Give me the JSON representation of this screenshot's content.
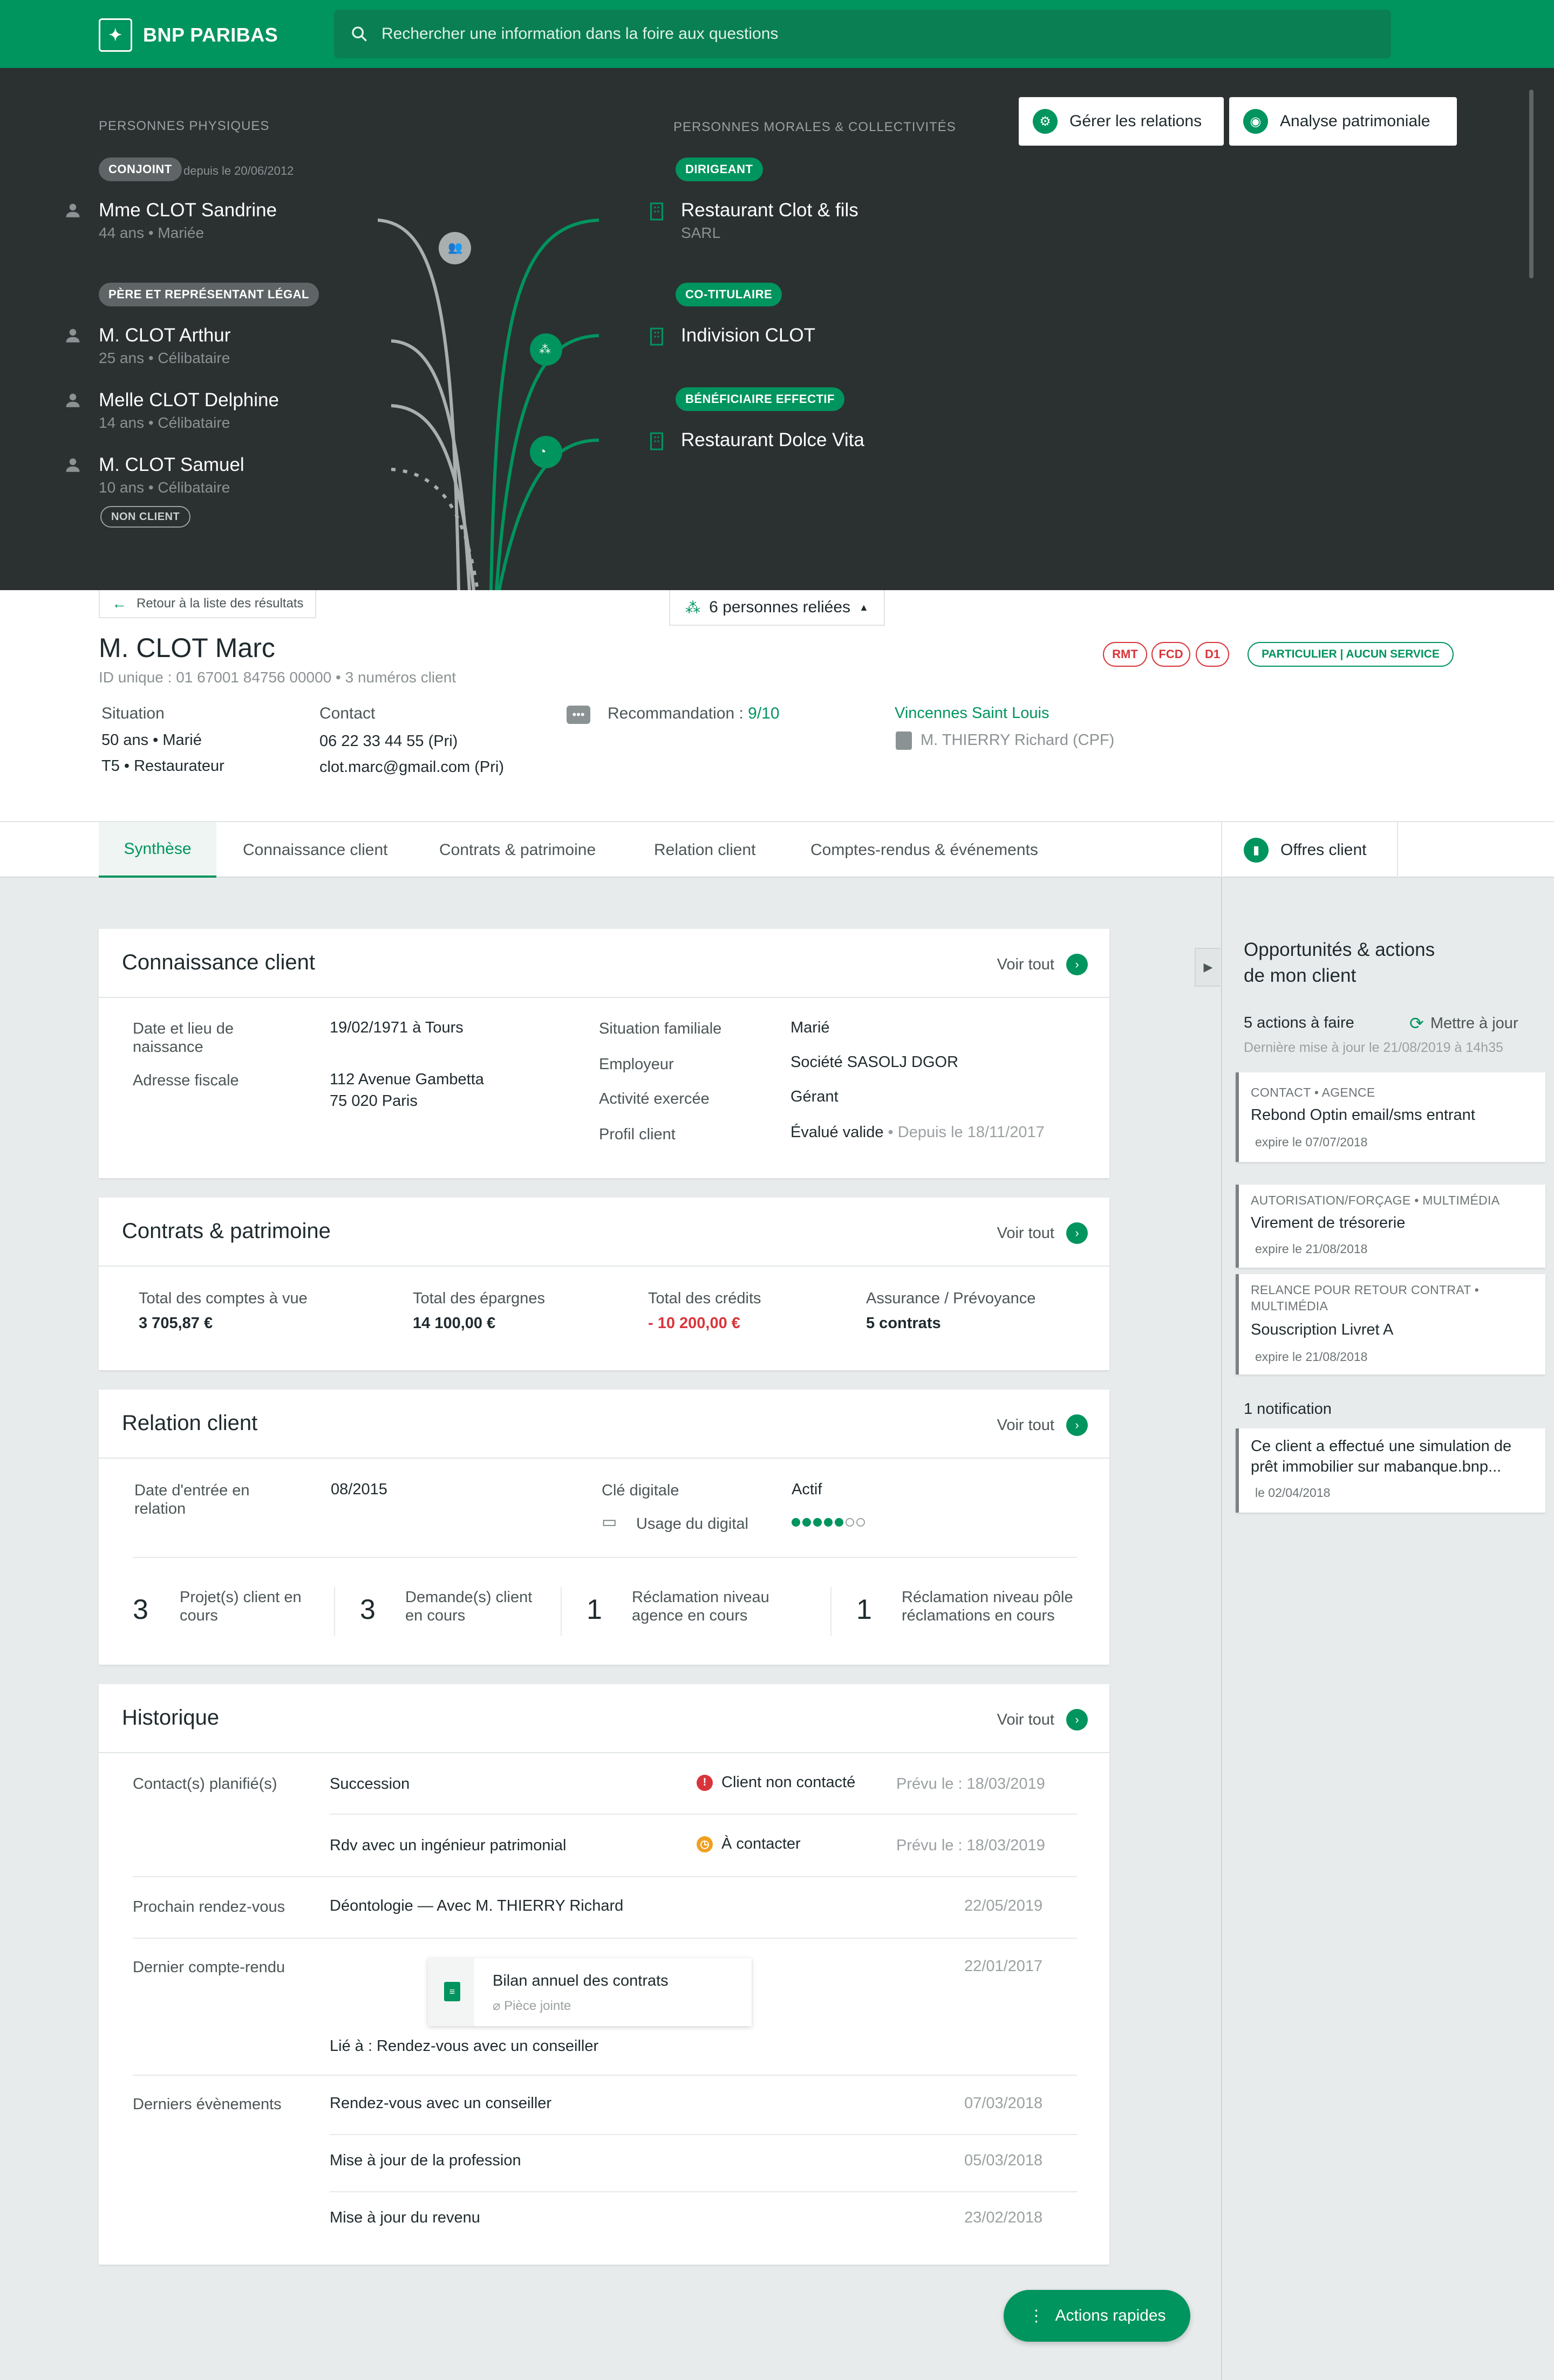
{
  "header": {
    "brand": "BNP PARIBAS",
    "search_placeholder": "Rechercher une information dans la foire aux questions"
  },
  "relations": {
    "physical_label": "PERSONNES PHYSIQUES",
    "moral_label": "PERSONNES MORALES & COLLECTIVITÉS",
    "manage_button": "Gérer les relations",
    "analysis_button": "Analyse patrimoniale",
    "physical": [
      {
        "tag": "CONJOINT",
        "since": "depuis le 20/06/2012",
        "name": "Mme CLOT Sandrine",
        "sub": "44 ans • Mariée"
      },
      {
        "tag": "PÈRE ET REPRÉSENTANT LÉGAL",
        "name": "M. CLOT Arthur",
        "sub": "25 ans • Célibataire"
      },
      {
        "name": "Melle CLOT Delphine",
        "sub": "14 ans • Célibataire"
      },
      {
        "name": "M. CLOT Samuel",
        "sub": "10 ans • Célibataire",
        "badge": "NON CLIENT"
      }
    ],
    "moral": [
      {
        "tag": "DIRIGEANT",
        "name": "Restaurant Clot & fils",
        "sub": "SARL"
      },
      {
        "tag": "CO-TITULAIRE",
        "name": "Indivision CLOT"
      },
      {
        "tag": "BÉNÉFICIAIRE EFFECTIF",
        "name": "Restaurant Dolce Vita"
      }
    ]
  },
  "client": {
    "back_label": "Retour à la liste des résultats",
    "linked_label": "6 personnes reliées",
    "name": "M. CLOT Marc",
    "id_line": "ID unique : 01 67001 84756 00000 • 3 numéros client",
    "tags": [
      "RMT",
      "FCD",
      "D1"
    ],
    "segment": "PARTICULIER | AUCUN SERVICE",
    "situation_label": "Situation",
    "situation_1": "50 ans • Marié",
    "situation_2": "T5 • Restaurateur",
    "contact_label": "Contact",
    "phone": "06 22 33 44 55 (Pri)",
    "email": "clot.marc@gmail.com (Pri)",
    "reco_label": "Recommandation :",
    "reco_value": "9/10",
    "agency": "Vincennes Saint Louis",
    "advisor": "M. THIERRY Richard (CPF)"
  },
  "tabs": [
    "Synthèse",
    "Connaissance client",
    "Contrats & patrimoine",
    "Relation client",
    "Comptes-rendus & événements"
  ],
  "offers_label": "Offres client",
  "see_all": "Voir tout",
  "knowledge": {
    "title": "Connaissance client",
    "birth_label": "Date et lieu de naissance",
    "birth_value": "19/02/1971 à Tours",
    "address_label": "Adresse fiscale",
    "address_1": "112 Avenue Gambetta",
    "address_2": "75 020 Paris",
    "family_label": "Situation familiale",
    "family_value": "Marié",
    "employer_label": "Employeur",
    "employer_value": "Société SASOLJ DGOR",
    "activity_label": "Activité exercée",
    "activity_value": "Gérant",
    "profile_label": "Profil client",
    "profile_value": "Évalué valide",
    "profile_since": " • Depuis le 18/11/2017"
  },
  "contracts": {
    "title": "Contrats & patrimoine",
    "items": [
      {
        "label": "Total des comptes à vue",
        "value": "3 705,87 €"
      },
      {
        "label": "Total des épargnes",
        "value": "14 100,00 €"
      },
      {
        "label": "Total des crédits",
        "value": "- 10 200,00 €"
      },
      {
        "label": "Assurance / Prévoyance",
        "value": "5 contrats"
      }
    ]
  },
  "relation": {
    "title": "Relation client",
    "entry_label": "Date d'entrée en relation",
    "entry_value": "08/2015",
    "digital_key_label": "Clé digitale",
    "digital_key_value": "Actif",
    "digital_usage_label": "Usage du digital",
    "digital_usage_level": 5,
    "digital_usage_max": 7,
    "stats": [
      {
        "num": "3",
        "label": "Projet(s) client en cours"
      },
      {
        "num": "3",
        "label": "Demande(s) client en cours"
      },
      {
        "num": "1",
        "label": "Réclamation niveau agence en cours"
      },
      {
        "num": "1",
        "label": "Réclamation niveau pôle réclamations en cours"
      }
    ]
  },
  "history": {
    "title": "Historique",
    "planned_label": "Contact(s) planifié(s)",
    "planned": [
      {
        "text": "Succession",
        "status": "Client non contacté",
        "status_color": "#d9343a",
        "date": "Prévu le : 18/03/2019"
      },
      {
        "text": "Rdv avec un ingénieur patrimonial",
        "status": "À contacter",
        "status_color": "#f0a020",
        "date": "Prévu le : 18/03/2019"
      }
    ],
    "next_label": "Prochain rendez-vous",
    "next_text": "Déontologie — Avec M. THIERRY Richard",
    "next_date": "22/05/2019",
    "last_report_label": "Dernier compte-rendu",
    "last_report_title": "Bilan annuel des contrats",
    "last_report_attachment": "Pièce jointe",
    "last_report_date": "22/01/2017",
    "last_report_link": "Lié à : Rendez-vous avec un conseiller",
    "events_label": "Derniers évènements",
    "events": [
      {
        "text": "Rendez-vous avec un conseiller",
        "date": "07/03/2018"
      },
      {
        "text": "Mise à jour de la profession",
        "date": "05/03/2018"
      },
      {
        "text": "Mise à jour du revenu",
        "date": "23/02/2018"
      }
    ]
  },
  "quick_actions": "Actions rapides",
  "opportunities": {
    "title_1": "Opportunités & actions",
    "title_2": "de mon client",
    "actions_count": "5 actions à faire",
    "refresh": "Mettre à jour",
    "last_update": "Dernière mise à jour le 21/08/2019 à 14h35",
    "actions": [
      {
        "cat": "CONTACT • AGENCE",
        "title": "Rebond Optin email/sms entrant",
        "exp": "expire le 07/07/2018"
      },
      {
        "cat": "AUTORISATION/FORÇAGE • MULTIMÉDIA",
        "title": "Virement de trésorerie",
        "exp": "expire le 21/08/2018"
      },
      {
        "cat": "RELANCE POUR RETOUR CONTRAT •",
        "cat2": "MULTIMÉDIA",
        "title": "Souscription Livret A",
        "exp": "expire le 21/08/2018"
      }
    ],
    "notif_count": "1 notification",
    "notif_1": "Ce client a effectué une simulation de",
    "notif_2": "prêt immobilier sur mabanque.bnp...",
    "notif_date": "le 02/04/2018"
  }
}
